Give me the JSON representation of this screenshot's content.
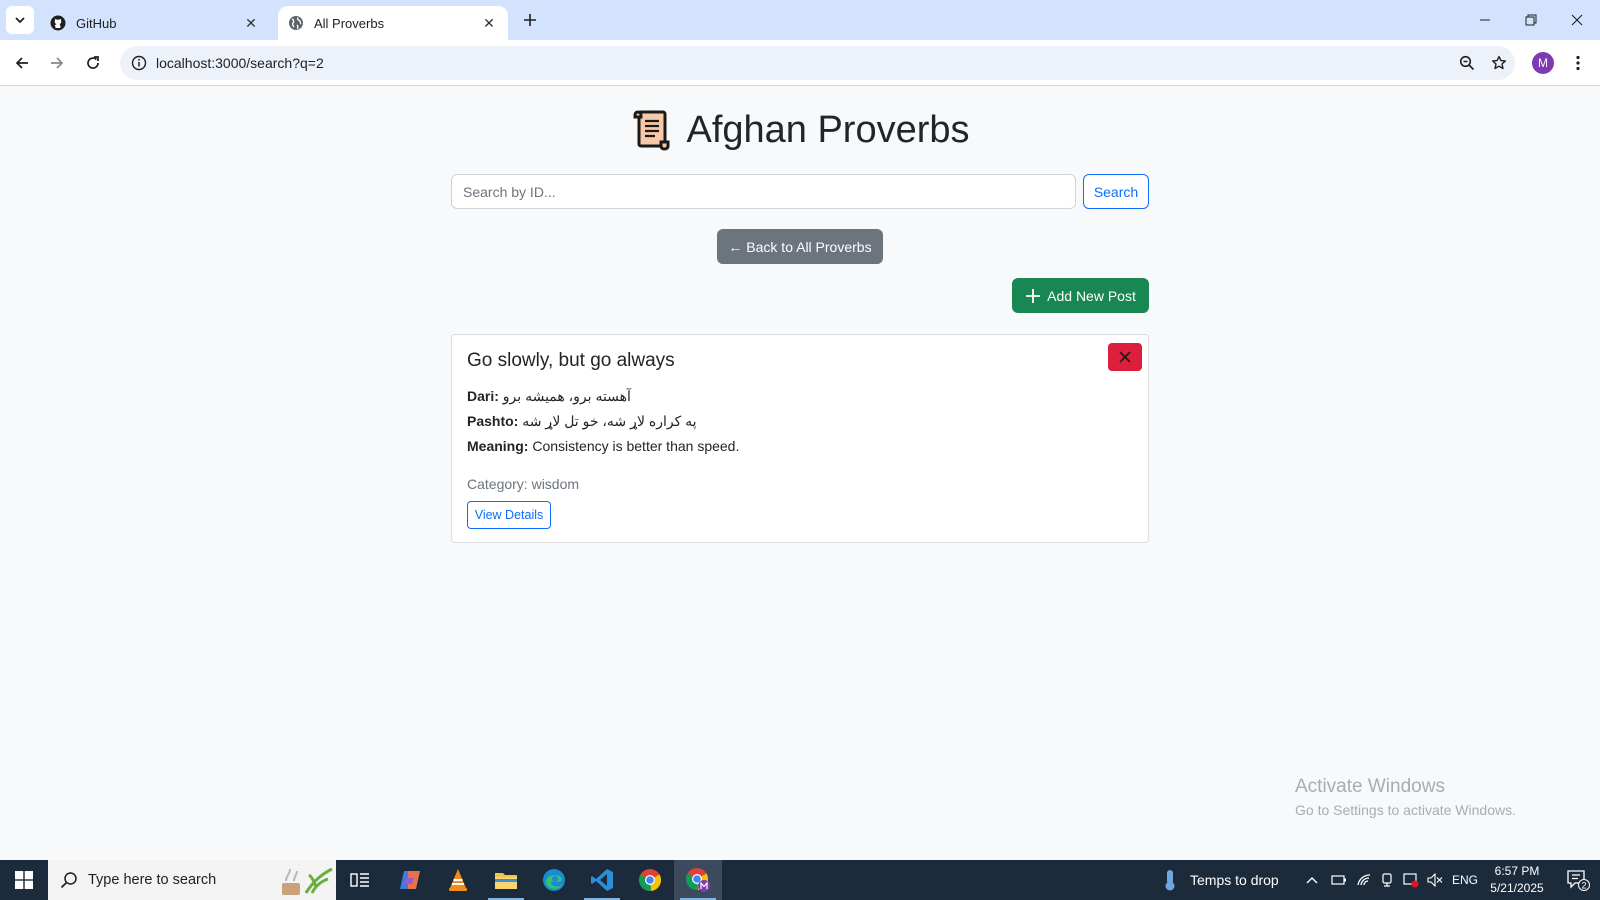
{
  "browser": {
    "tabs": [
      {
        "title": "GitHub",
        "icon": "github-icon",
        "active": false
      },
      {
        "title": "All Proverbs",
        "icon": "globe-icon",
        "active": true
      }
    ],
    "url": "localhost:3000/search?q=2",
    "profile_initial": "M"
  },
  "page": {
    "heading": "Afghan Proverbs",
    "search": {
      "placeholder": "Search by ID...",
      "button_label": "Search"
    },
    "back_label": "← Back to All Proverbs",
    "add_label": "Add New Post",
    "card": {
      "title": "Go slowly, but go always",
      "dari_label": "Dari:",
      "dari_text": "آهسته برو، همیشه برو",
      "pashto_label": "Pashto:",
      "pashto_text": "په کراره لاړ شه، خو تل لاړ شه",
      "meaning_label": "Meaning:",
      "meaning_text": "Consistency is better than speed.",
      "category": "Category: wisdom",
      "view_label": "View Details"
    }
  },
  "watermark": {
    "line1": "Activate Windows",
    "line2": "Go to Settings to activate Windows."
  },
  "taskbar": {
    "search_placeholder": "Type here to search",
    "weather": "Temps to drop",
    "lang": "ENG",
    "time": "6:57 PM",
    "date": "5/21/2025",
    "notification_count": "2"
  },
  "colors": {
    "primary": "#0d6efd",
    "secondary": "#6c757d",
    "success": "#198754",
    "danger": "#dc1f3c",
    "tabstrip": "#d3e3fd",
    "taskbar": "#1c2b3c"
  }
}
